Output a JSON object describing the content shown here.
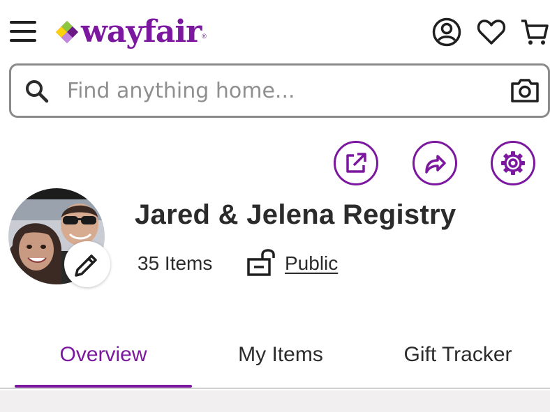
{
  "header": {
    "logo_text": "wayfair",
    "logo_tm": "®",
    "menu_icon": "hamburger-menu-icon",
    "account_icon": "account-icon",
    "favorites_icon": "heart-icon",
    "cart_icon": "cart-icon"
  },
  "search": {
    "placeholder": "Find anything home...",
    "value": "",
    "search_icon": "search-icon",
    "camera_icon": "camera-icon"
  },
  "actions": {
    "items": [
      {
        "name": "open-external",
        "icon": "external-link-icon"
      },
      {
        "name": "share",
        "icon": "share-arrow-icon"
      },
      {
        "name": "settings",
        "icon": "gear-icon"
      }
    ]
  },
  "registry": {
    "title": "Jared & Jelena Registry",
    "item_count": "35 Items",
    "privacy": "Public",
    "privacy_icon": "unlocked-padlock-icon",
    "edit_icon": "pencil-icon"
  },
  "tabs": [
    {
      "label": "Overview",
      "active": true
    },
    {
      "label": "My Items",
      "active": false
    },
    {
      "label": "Gift Tracker",
      "active": false
    }
  ],
  "colors": {
    "brand_purple": "#7b189f",
    "text": "#2b2b2b",
    "logo_green": "#8dc63f",
    "logo_yellow": "#fcd20c",
    "logo_pink": "#c386e0",
    "logo_darkpurple": "#6b1a85"
  }
}
